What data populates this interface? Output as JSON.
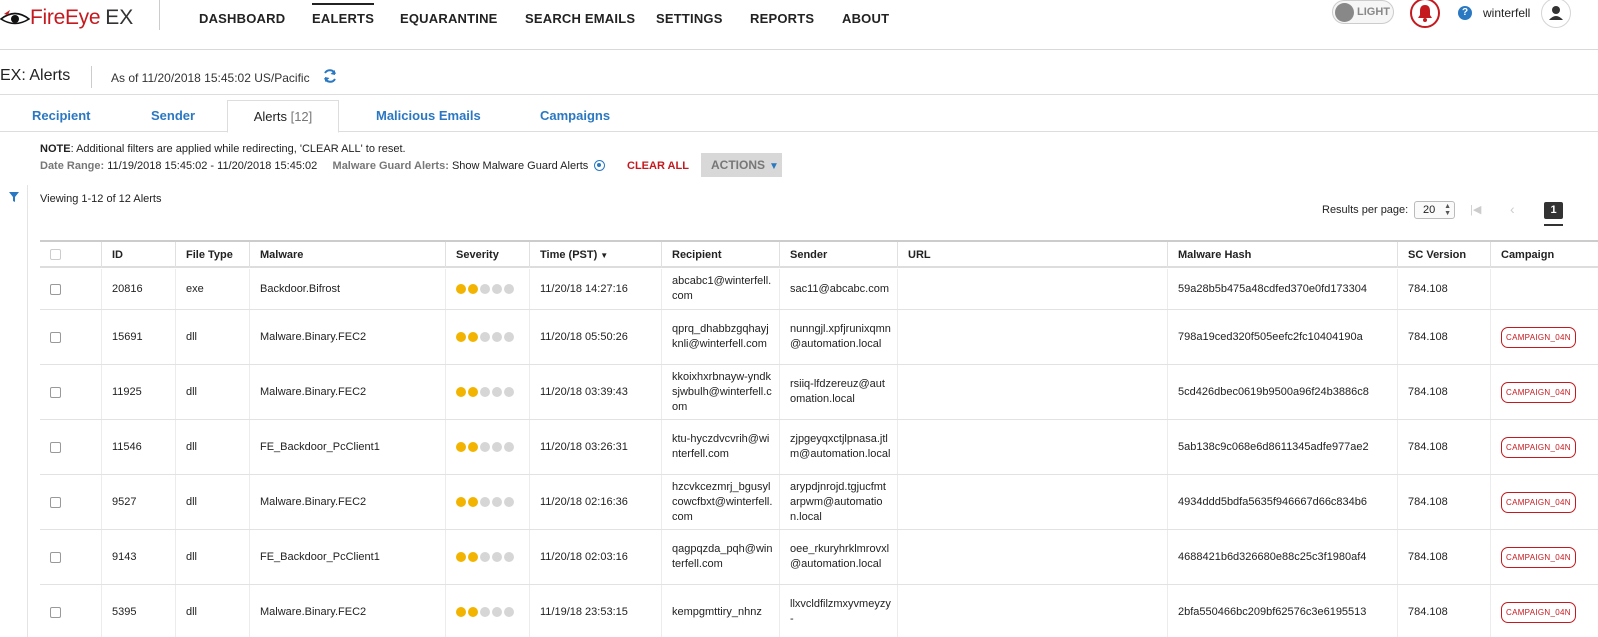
{
  "brand": {
    "name": "FireEye",
    "product": "EX"
  },
  "nav": [
    "DASHBOARD",
    "EALERTS",
    "EQUARANTINE",
    "SEARCH EMAILS",
    "SETTINGS",
    "REPORTS",
    "ABOUT"
  ],
  "nav_active": "EALERTS",
  "theme_toggle": "LIGHT",
  "help": "?",
  "username": "winterfell",
  "page": {
    "title": "EX: Alerts",
    "as_of": "As of 11/20/2018 15:45:02 US/Pacific"
  },
  "tabs": [
    {
      "label": "Recipient"
    },
    {
      "label": "Sender"
    },
    {
      "label": "Alerts",
      "count": "[12]"
    },
    {
      "label": "Malicious Emails"
    },
    {
      "label": "Campaigns"
    }
  ],
  "filters": {
    "note_label": "NOTE",
    "note_text": ": Additional filters are applied while redirecting, 'CLEAR ALL' to reset.",
    "date_label": "Date Range:",
    "date_value": "11/19/2018 15:45:02 - 11/20/2018 15:45:02",
    "mg_label": "Malware Guard Alerts:",
    "mg_value": "Show Malware Guard Alerts",
    "clear_all": "CLEAR ALL",
    "actions": "ACTIONS"
  },
  "viewing": "Viewing 1-12 of 12 Alerts",
  "pagination": {
    "rpp_label": "Results per page:",
    "rpp_value": "20",
    "current": "1"
  },
  "columns": [
    "ID",
    "File Type",
    "Malware",
    "Severity",
    "Time (PST)",
    "Recipient",
    "Sender",
    "URL",
    "Malware Hash",
    "SC Version",
    "Campaign"
  ],
  "rows": [
    {
      "id": "20816",
      "type": "exe",
      "malware": "Backdoor.Bifrost",
      "severity": 2,
      "time": "11/20/18 14:27:16",
      "recipient": "abcabc1@winterfell.com",
      "sender": "sac11@abcabc.com",
      "url": "",
      "hash": "59a28b5b475a48cdfed370e0fd173304",
      "sc": "784.108",
      "campaign": ""
    },
    {
      "id": "15691",
      "type": "dll",
      "malware": "Malware.Binary.FEC2",
      "severity": 2,
      "time": "11/20/18 05:50:26",
      "recipient": "qprq_dhabbzgqhayjknli@winterfell.com",
      "sender": "nunngjl.xpfjrunixqmn@automation.local",
      "url": "",
      "hash": "798a19ced320f505eefc2fc10404190a",
      "sc": "784.108",
      "campaign": "CAMPAIGN_04N"
    },
    {
      "id": "11925",
      "type": "dll",
      "malware": "Malware.Binary.FEC2",
      "severity": 2,
      "time": "11/20/18 03:39:43",
      "recipient": "kkoixhxrbnayw-yndksjwbulh@winterfell.com",
      "sender": "rsiiq-lfdzereuz@automation.local",
      "url": "",
      "hash": "5cd426dbec0619b9500a96f24b3886c8",
      "sc": "784.108",
      "campaign": "CAMPAIGN_04N"
    },
    {
      "id": "11546",
      "type": "dll",
      "malware": "FE_Backdoor_PcClient1",
      "severity": 2,
      "time": "11/20/18 03:26:31",
      "recipient": "ktu-hyczdvcvrih@winterfell.com",
      "sender": "zjpgeyqxctjlpnasa.jtlm@automation.local",
      "url": "",
      "hash": "5ab138c9c068e6d8611345adfe977ae2",
      "sc": "784.108",
      "campaign": "CAMPAIGN_04N"
    },
    {
      "id": "9527",
      "type": "dll",
      "malware": "Malware.Binary.FEC2",
      "severity": 2,
      "time": "11/20/18 02:16:36",
      "recipient": "hzcvkcezmrj_bgusylcowcfbxt@winterfell.com",
      "sender": "arypdjnrojd.tgjucfmtarpwm@automation.local",
      "url": "",
      "hash": "4934ddd5bdfa5635f946667d66c834b6",
      "sc": "784.108",
      "campaign": "CAMPAIGN_04N"
    },
    {
      "id": "9143",
      "type": "dll",
      "malware": "FE_Backdoor_PcClient1",
      "severity": 2,
      "time": "11/20/18 02:03:16",
      "recipient": "qagpqzda_pqh@winterfell.com",
      "sender": "oee_rkuryhrklmrovxl@automation.local",
      "url": "",
      "hash": "4688421b6d326680e88c25c3f1980af4",
      "sc": "784.108",
      "campaign": "CAMPAIGN_04N"
    },
    {
      "id": "5395",
      "type": "dll",
      "malware": "Malware.Binary.FEC2",
      "severity": 2,
      "time": "11/19/18 23:53:15",
      "recipient": "kempgmttiry_nhnz",
      "sender": "llxvcldfilzmxyvmeyzy-",
      "url": "",
      "hash": "2bfa550466bc209bf62576c3e6195513",
      "sc": "784.108",
      "campaign": "CAMPAIGN_04N"
    }
  ],
  "colors": {
    "brand_red": "#c41a1f",
    "link_blue": "#2a78c2",
    "severity_on": "#f2b400",
    "severity_off": "#d6d6d6"
  },
  "icons": [
    "fireeye-logo-icon",
    "bell-icon",
    "help-icon",
    "user-avatar-icon",
    "refresh-icon",
    "filter-icon",
    "malware-guard-icon",
    "chevron-down-icon",
    "first-page-icon",
    "prev-page-icon"
  ]
}
